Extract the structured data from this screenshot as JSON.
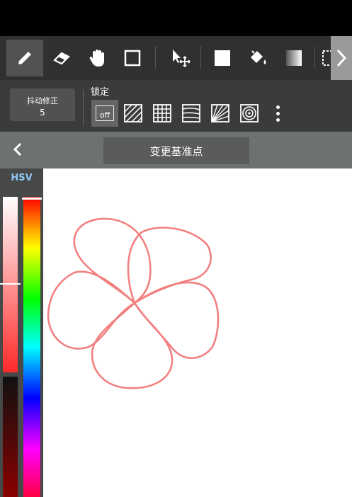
{
  "toolbar": {
    "tools": [
      "pen-icon",
      "eraser-icon",
      "hand-icon",
      "square-icon",
      "move-icon",
      "fill-square-icon",
      "bucket-icon",
      "gradient-icon",
      "selection-icon"
    ],
    "active_tool": "pen-icon"
  },
  "options": {
    "stabilizer_label": "抖动修正",
    "stabilizer_value": "5",
    "lock_title": "锁定",
    "lock_off_label": "off",
    "lock_modes": [
      "off",
      "parallel-lines",
      "grid",
      "curved-lines",
      "radial-lines",
      "concentric-circles"
    ]
  },
  "subbar": {
    "pivot_button_label": "变更基准点"
  },
  "color_panel": {
    "tab_label": "HSV",
    "selected_color": "#f08080"
  },
  "drawing": {
    "stroke_color": "#f28080",
    "shape": "five-petal flower outline"
  }
}
